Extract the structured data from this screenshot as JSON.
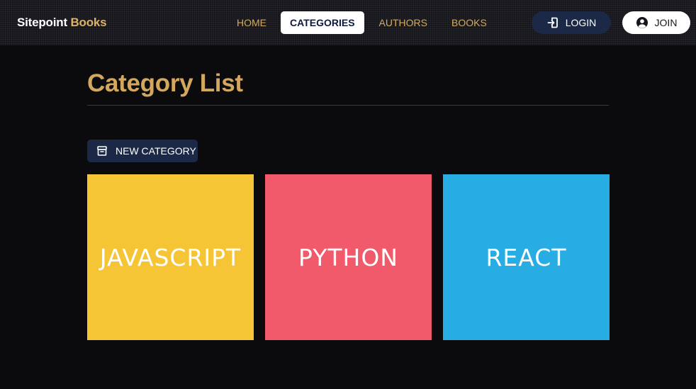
{
  "brand": {
    "name": "Sitepoint",
    "accent": "Books"
  },
  "nav": {
    "links": [
      {
        "label": "HOME",
        "active": false
      },
      {
        "label": "CATEGORIES",
        "active": true
      },
      {
        "label": "AUTHORS",
        "active": false
      },
      {
        "label": "BOOKS",
        "active": false
      }
    ],
    "login_label": "LOGIN",
    "join_label": "JOIN"
  },
  "page": {
    "title": "Category List",
    "new_button_label": "NEW CATEGORY"
  },
  "categories": [
    {
      "name": "JAVASCRIPT",
      "color": "#f6c535"
    },
    {
      "name": "PYTHON",
      "color": "#f05a6a"
    },
    {
      "name": "REACT",
      "color": "#27ade3"
    }
  ],
  "colors": {
    "accent": "#d4a75f",
    "navy": "#1b2846",
    "background": "#0b0b0d"
  },
  "icons": {
    "login": "login-icon",
    "join": "user-circle-icon",
    "new_category": "archive-icon"
  }
}
